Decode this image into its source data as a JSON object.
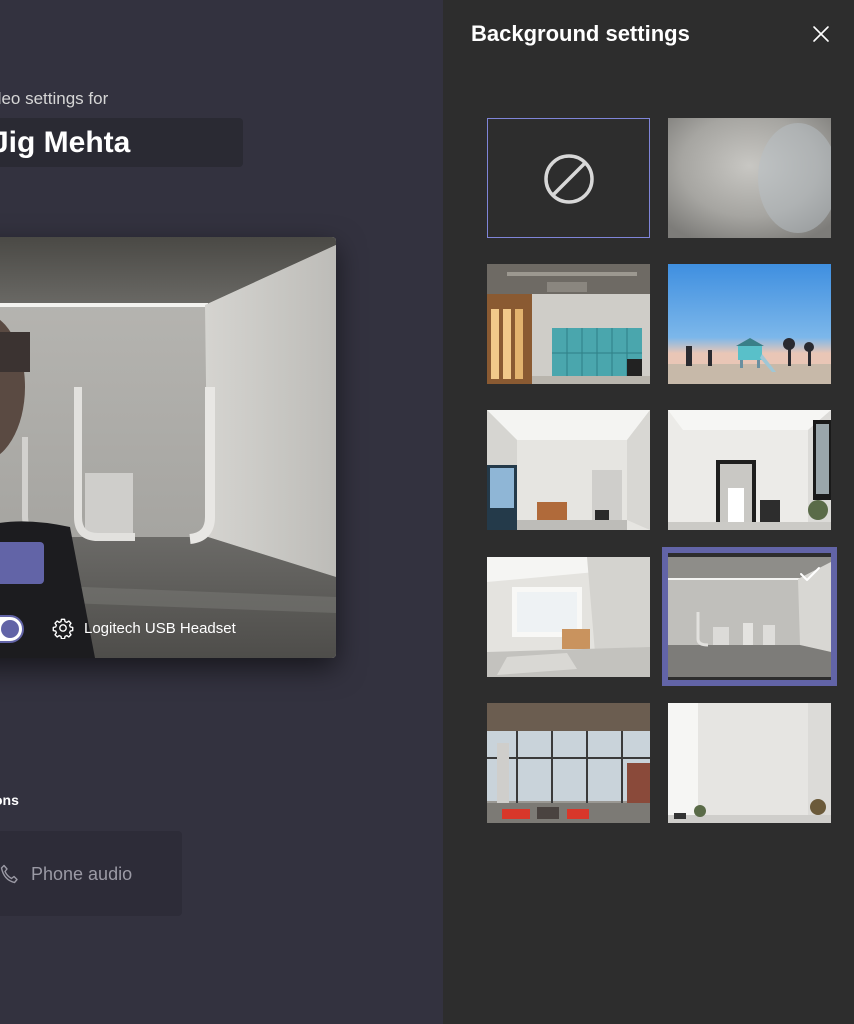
{
  "left_pane": {
    "subtitle": "deo settings for",
    "meeting_name": "Jig Mehta",
    "device_name": "Logitech USB Headset",
    "options_label": "ons",
    "phone_audio_label": "Phone audio"
  },
  "panel": {
    "title": "Background settings",
    "close_icon": "close-icon",
    "selected_tile": "studio-curves",
    "tiles": [
      {
        "name": "none",
        "icon": "no-background-icon"
      },
      {
        "name": "blur"
      },
      {
        "name": "office-lockers"
      },
      {
        "name": "beach-lifeguard"
      },
      {
        "name": "loft-windows"
      },
      {
        "name": "mirror-room"
      },
      {
        "name": "bright-loft"
      },
      {
        "name": "studio-curves",
        "selected": true
      },
      {
        "name": "industrial-lounge"
      },
      {
        "name": "white-room-plants"
      }
    ]
  },
  "colors": {
    "accent": "#6264a7",
    "left_bg": "#33323f",
    "panel_bg": "#2d2d2d"
  }
}
